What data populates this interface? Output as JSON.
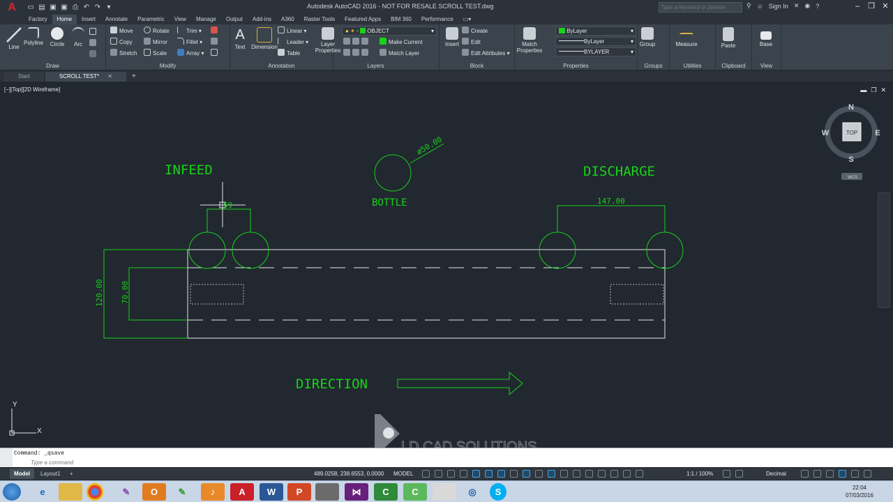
{
  "window": {
    "title": "Autodesk AutoCAD 2016 - NOT FOR RESALE   SCROLL TEST.dwg",
    "search_placeholder": "Type a keyword or phrase",
    "sign_in": "Sign In"
  },
  "ribbon_tabs": [
    "Factory",
    "Home",
    "Insert",
    "Annotate",
    "Parametric",
    "View",
    "Manage",
    "Output",
    "Add-ins",
    "A360",
    "Raster Tools",
    "Featured Apps",
    "BIM 360",
    "Performance"
  ],
  "ribbon": {
    "draw": {
      "title": "Draw",
      "tools": [
        "Line",
        "Polyline",
        "Circle",
        "Arc"
      ]
    },
    "modify": {
      "title": "Modify",
      "row1": [
        "Move",
        "Rotate",
        "Trim"
      ],
      "row2": [
        "Copy",
        "Mirror",
        "Fillet"
      ],
      "row3": [
        "Stretch",
        "Scale",
        "Array"
      ]
    },
    "annotation": {
      "title": "Annotation",
      "text": "Text",
      "dimension": "Dimension",
      "linear": "Linear",
      "leader": "Leader",
      "table": "Table"
    },
    "layers": {
      "title": "Layers",
      "layer_properties": "Layer Properties",
      "current_layer": "OBJECT",
      "make_current": "Make Current",
      "match_layer": "Match Layer"
    },
    "block": {
      "title": "Block",
      "insert": "Insert",
      "create": "Create",
      "edit": "Edit",
      "edit_attributes": "Edit Attributes"
    },
    "properties": {
      "title": "Properties",
      "match_properties": "Match Properties",
      "color": "ByLayer",
      "linetype": "ByLayer",
      "lineweight": "BYLAYER"
    },
    "groups": {
      "title": "Groups",
      "group": "Group"
    },
    "utilities": {
      "title": "Utilities",
      "measure": "Measure"
    },
    "clipboard": {
      "title": "Clipboard",
      "paste": "Paste"
    },
    "view": {
      "title": "View",
      "base": "Base"
    }
  },
  "file_tabs": {
    "start": "Start",
    "active": "SCROLL TEST*"
  },
  "viewport": {
    "label": "[−][Top][2D Wireframe]",
    "viewcube": {
      "n": "N",
      "s": "S",
      "e": "E",
      "w": "W",
      "top": "TOP",
      "wcs": "WCS"
    }
  },
  "drawing": {
    "infeed": "INFEED",
    "discharge": "DISCHARGE",
    "bottle": "BOTTLE",
    "direction": "DIRECTION",
    "diameter_label": "ø50.00",
    "dim_infeed_gap": "59",
    "dim_discharge_gap": "147.00",
    "dim_height_outer": "120.00",
    "dim_height_inner": "70.00",
    "ucs_x": "X",
    "ucs_y": "Y",
    "watermark": "LD CAD SOLUTIONS"
  },
  "command": {
    "history": "Command: _qsave",
    "placeholder": "Type a command"
  },
  "status": {
    "model_tab": "Model",
    "layout_tab": "Layout1",
    "coordinates": "489.0258, 238.6553, 0.0000",
    "model_button": "MODEL",
    "scale": "1:1 / 100%",
    "units": "Decimal"
  },
  "taskbar": {
    "time": "22:04",
    "date": "07/03/2016"
  },
  "colors": {
    "drawing_green": "#19d219",
    "geometry_white": "#e6e6e6",
    "canvas_bg": "#212830"
  }
}
